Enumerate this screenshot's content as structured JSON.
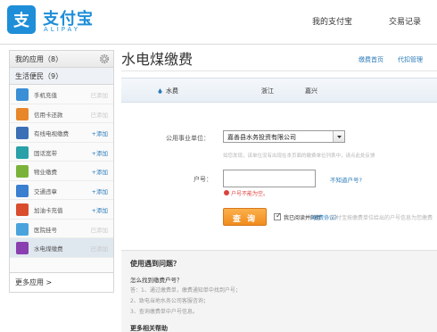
{
  "brand": {
    "name_cn": "支付宝",
    "name_en": "ALIPAY",
    "accent": "#1e8ed8"
  },
  "topnav": {
    "my_alipay": "我的支付宝",
    "transactions": "交易记录"
  },
  "sidebar": {
    "my_apps": "我的应用（8）",
    "life_services": "生活便民（9）",
    "items": [
      {
        "label": "手机充值",
        "action": "已添加",
        "icon": "phone-icon",
        "color": "#3a8fd6"
      },
      {
        "label": "信用卡还款",
        "action": "已添加",
        "icon": "credit-card-icon",
        "color": "#e8862a"
      },
      {
        "label": "有线电视缴费",
        "action": "+添加",
        "icon": "tv-icon",
        "color": "#3b6fb6"
      },
      {
        "label": "固话宽带",
        "action": "+添加",
        "icon": "broadband-icon",
        "color": "#2aa0a8"
      },
      {
        "label": "物业缴费",
        "action": "+添加",
        "icon": "property-icon",
        "color": "#7bb33a"
      },
      {
        "label": "交通违章",
        "action": "+添加",
        "icon": "traffic-icon",
        "color": "#3a7fd0"
      },
      {
        "label": "加油卡充值",
        "action": "+添加",
        "icon": "fuel-card-icon",
        "color": "#d94d2e"
      },
      {
        "label": "医院挂号",
        "action": "已添加",
        "icon": "hospital-icon",
        "color": "#4aa3dc"
      },
      {
        "label": "水电煤缴费",
        "action": "已添加",
        "icon": "utility-icon",
        "color": "#8a3fb0"
      }
    ],
    "more_apps": "更多应用 >"
  },
  "main": {
    "title": "水电煤缴费",
    "quick_links": [
      "缴费首页",
      "代扣管理"
    ],
    "bar": {
      "type": "水费",
      "province": "浙江",
      "city": "嘉兴"
    },
    "form": {
      "company_label": "公用事业单位：",
      "company_value": "嘉善县水务投资有限公司",
      "company_hint": "如您发现，该单位没有出现在本页面的缴费单位列表中，请点此处反馈",
      "account_label": "户号：",
      "account_value": "",
      "account_error": "户号不能为空。",
      "unknown_account": "不知道户号?",
      "query_button": "查 询",
      "agree_label": "我已阅读并同意",
      "agree_link": "《缴费协议》",
      "agree_hint": "支付宝按缴费单位给出的户号信息为您缴费"
    },
    "faq": {
      "title": "使用遇到问题？",
      "question": "怎么找到缴费户号？",
      "answers": [
        "答：1、通过缴费单，缴费通知单中找到户号；",
        "2、致电当地水务公司客服咨询；",
        "3、查询缴费单中户号信息。"
      ],
      "more": "更多相关帮助"
    }
  }
}
